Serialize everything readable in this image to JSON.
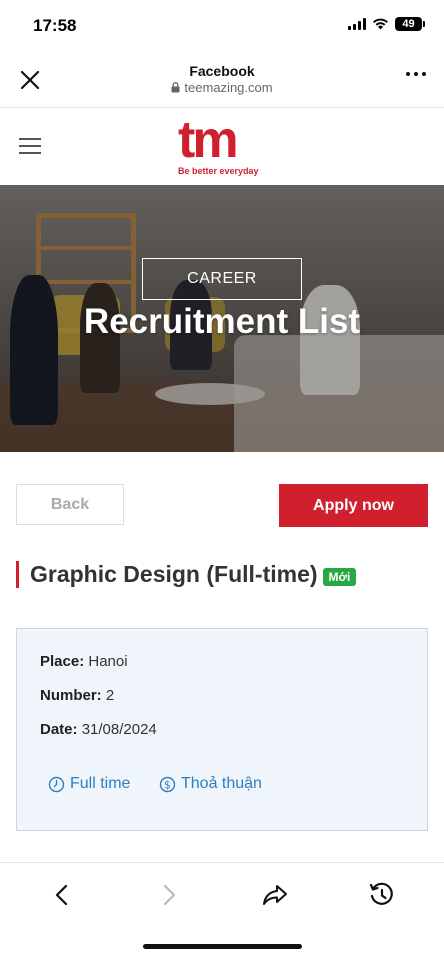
{
  "status_bar": {
    "time": "17:58",
    "battery": "49",
    "icons": [
      "signal-icon",
      "wifi-icon",
      "battery-icon"
    ]
  },
  "browser": {
    "title": "Facebook",
    "url": "teemazing.com",
    "icons": [
      "close-icon",
      "lock-icon",
      "more-icon"
    ]
  },
  "site": {
    "logo_mark": "tm",
    "logo_tagline": "Be better everyday",
    "brand_color": "#d0202e"
  },
  "hero": {
    "eyebrow": "CAREER",
    "title": "Recruitment List"
  },
  "actions": {
    "back_label": "Back",
    "apply_label": "Apply now"
  },
  "job": {
    "title": "Graphic Design (Full-time)",
    "badge": "Mới",
    "badge_color": "#28a745",
    "place_label": "Place:",
    "place_value": "Hanoi",
    "number_label": "Number:",
    "number_value": "2",
    "date_label": "Date:",
    "date_value": "31/08/2024",
    "tags": [
      {
        "icon": "clock-icon",
        "label": "Full time"
      },
      {
        "icon": "dollar-icon",
        "label": "Thoả thuận"
      }
    ]
  },
  "toolbar": {
    "icons": [
      "back-arrow-icon",
      "forward-arrow-icon",
      "share-icon",
      "history-icon"
    ]
  }
}
